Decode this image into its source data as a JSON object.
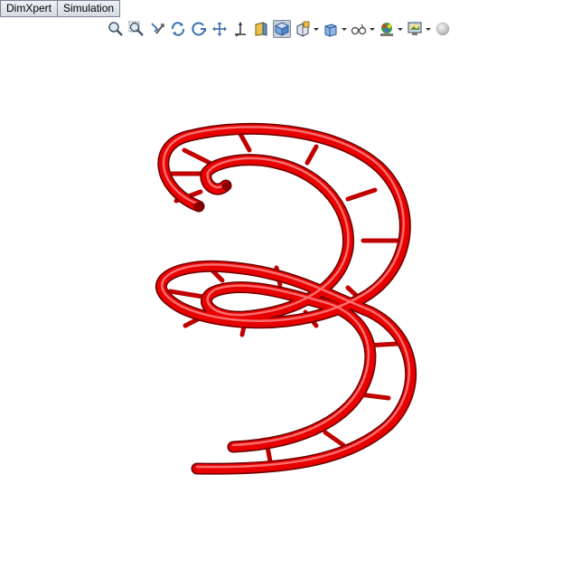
{
  "tabs": [
    {
      "label": "DimXpert"
    },
    {
      "label": "Simulation"
    }
  ],
  "toolbar": {
    "icons": [
      "zoom-to-fit-icon",
      "zoom-to-area-icon",
      "previous-view-icon",
      "rotate-view-icon",
      "rotate-about-icon",
      "pan-icon",
      "section-axis-icon",
      "section-view-icon",
      "view-orientation-icon",
      "display-style-icon",
      "hide-show-items-icon",
      "view-settings-icon",
      "appearance-icon",
      "scene-icon",
      "realview-icon"
    ]
  },
  "model": {
    "color": "#ee0000",
    "shape": "spiral-tube-frame"
  }
}
